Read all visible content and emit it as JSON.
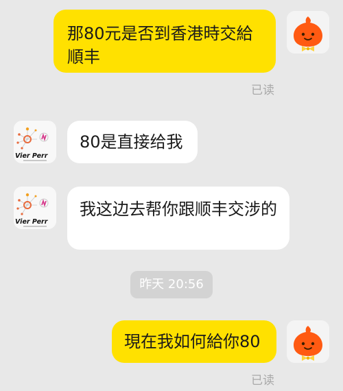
{
  "messages": [
    {
      "side": "out",
      "text": "那80元是否到香港時交給順丰",
      "status": "已读"
    },
    {
      "side": "in",
      "text": "80是直接给我"
    },
    {
      "side": "in",
      "text": "我这边去帮你跟顺丰交涉的"
    },
    {
      "side": "out",
      "text": "現在我如何給你80",
      "status": "已读"
    }
  ],
  "timestamp": "昨天  20:56",
  "contact_logo_text": "Vier Perr",
  "colors": {
    "outgoing_bubble": "#ffe100",
    "incoming_bubble": "#ffffff",
    "background": "#e8e8e8",
    "read_text": "#a9a9a9",
    "timestamp_pill": "#d3d3d3"
  },
  "icons": {
    "self_avatar": "orange-blob-mascot-with-bowtie",
    "contact_avatar": "molecule-network-logo"
  }
}
